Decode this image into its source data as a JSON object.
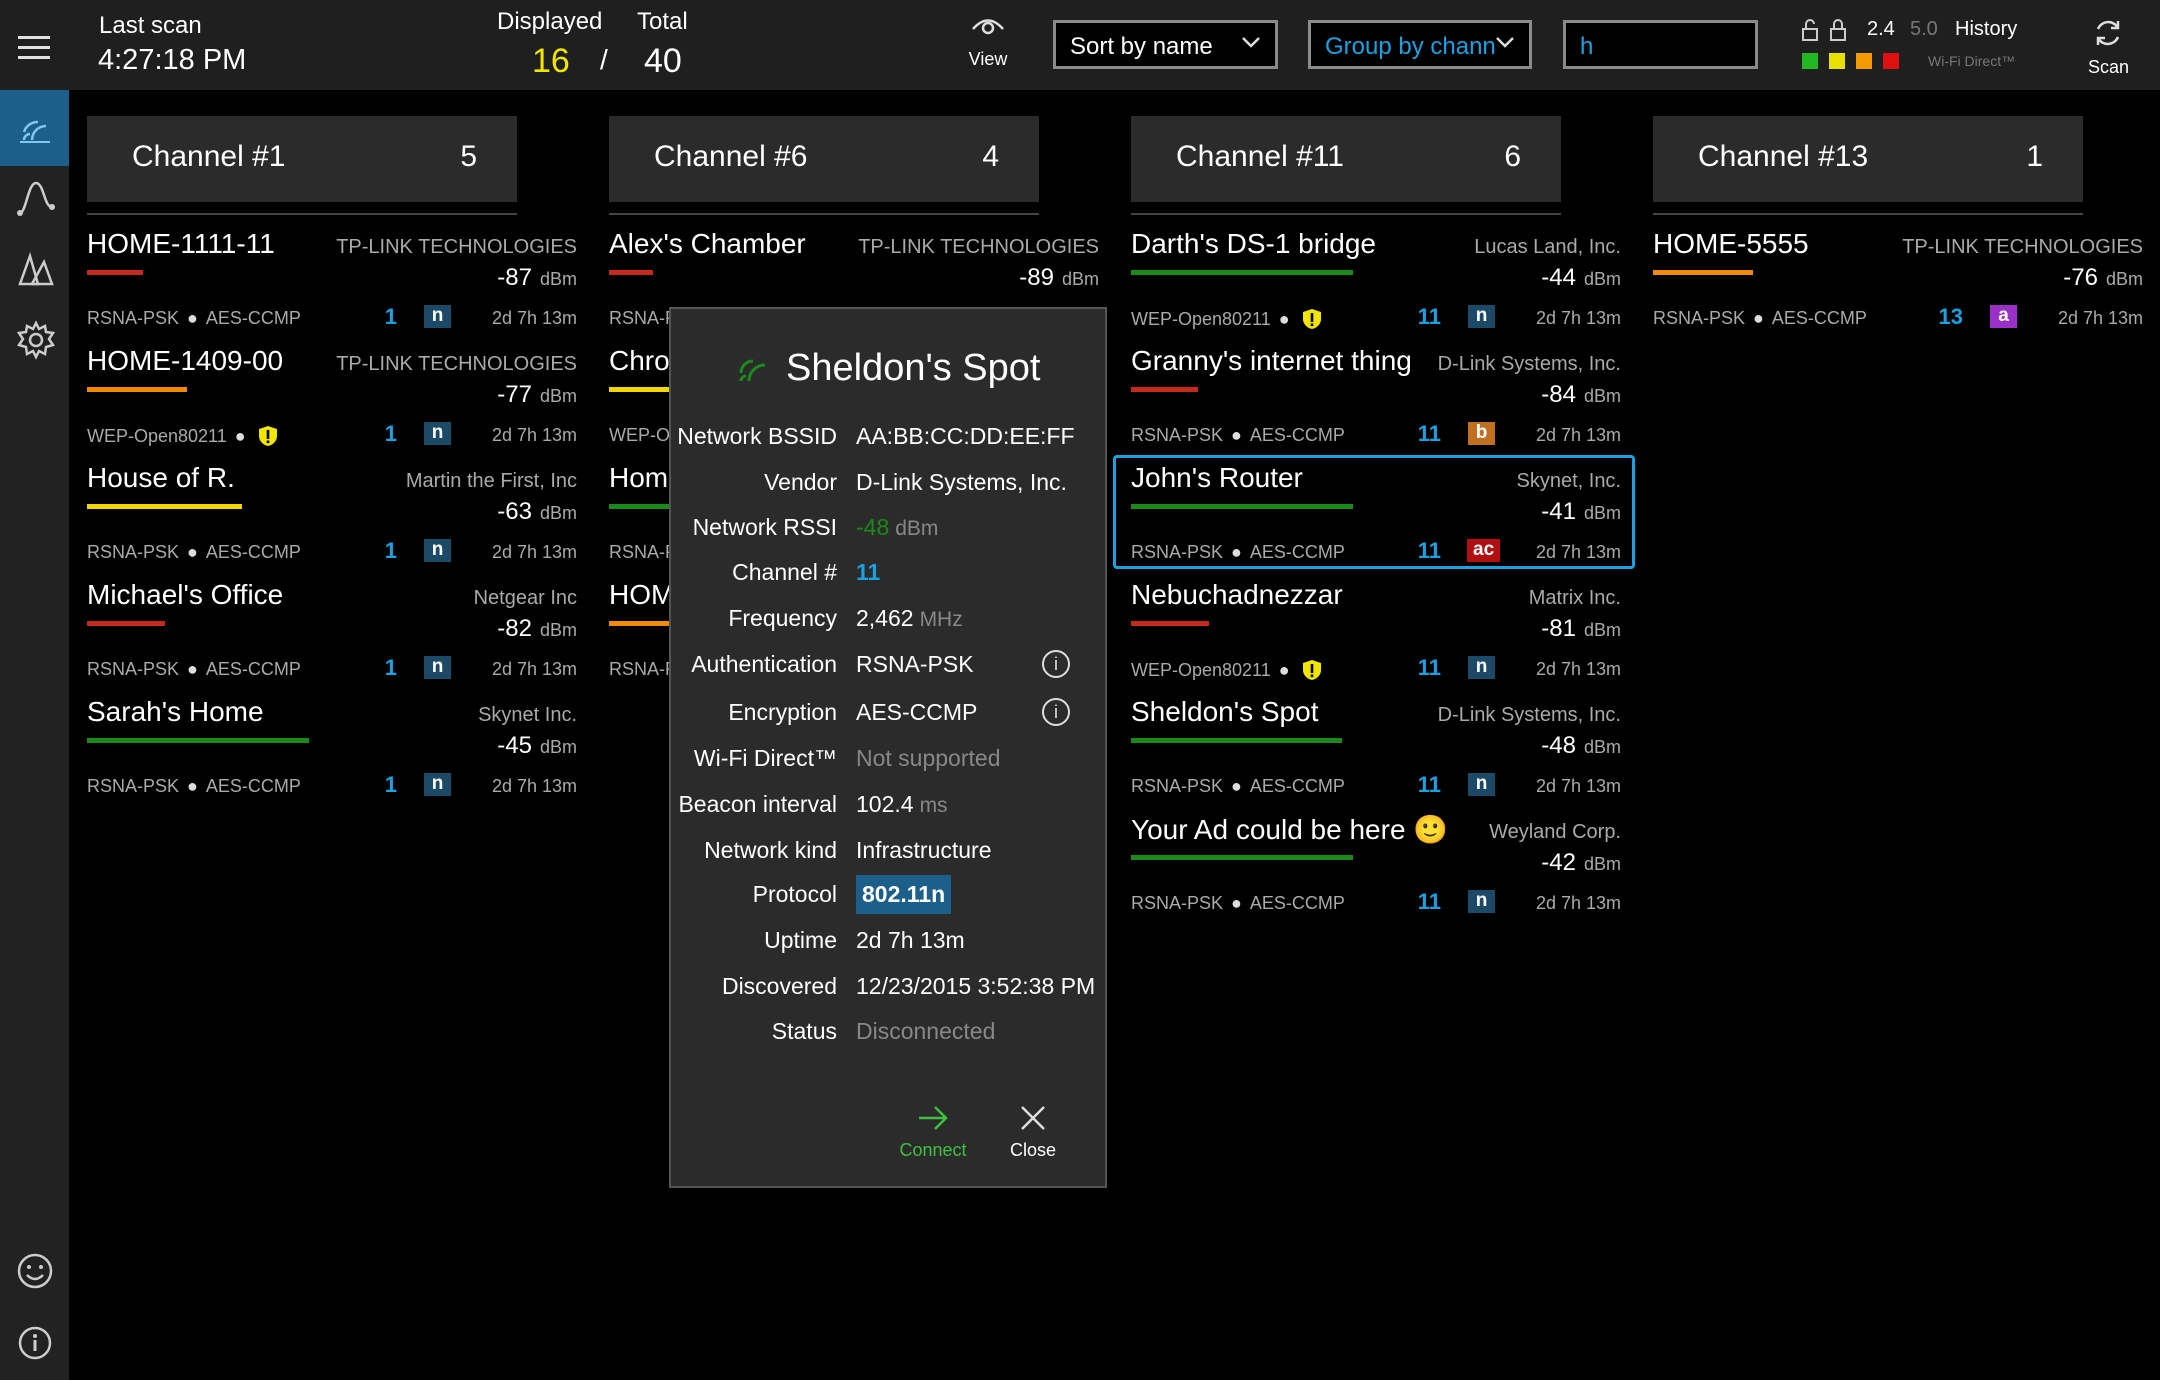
{
  "header": {
    "last_scan_label": "Last scan",
    "last_scan_time": "4:27:18 PM",
    "displayed_label": "Displayed",
    "displayed_value": "16",
    "separator": "/",
    "total_label": "Total",
    "total_value": "40",
    "view_label": "View",
    "sort_value": "Sort by name",
    "group_value": "Group by chann",
    "search_value": "h",
    "band_24": "2.4",
    "band_50": "5.0",
    "history_label": "History",
    "wifi_direct_label": "Wi-Fi Direct™",
    "scan_label": "Scan",
    "filter_colors": [
      "#22b822",
      "#e8e000",
      "#f59a00",
      "#e01010"
    ]
  },
  "sidebar": {
    "items": [
      {
        "icon": "wifi-list-icon",
        "active": true
      },
      {
        "icon": "graph-icon",
        "active": false
      },
      {
        "icon": "signal-map-icon",
        "active": false
      },
      {
        "icon": "gear-icon",
        "active": false
      }
    ],
    "bottom": [
      {
        "icon": "smiley-icon"
      },
      {
        "icon": "info-icon"
      }
    ]
  },
  "columns": [
    {
      "title": "Channel #1",
      "count": "5",
      "networks": [
        {
          "name": "HOME-1111-11",
          "vendor": "TP-LINK TECHNOLOGIES",
          "rssi": "-87",
          "unit": "dBm",
          "bar_color": "#c42b1c",
          "signal_fraction": 0.25,
          "security": "RSNA-PSK",
          "cipher": "AES-CCMP",
          "warning": false,
          "channel": "1",
          "protocol": "n",
          "protocol_color": "#1c4a66",
          "uptime": "2d 7h 13m"
        },
        {
          "name": "HOME-1409-00",
          "vendor": "TP-LINK TECHNOLOGIES",
          "rssi": "-77",
          "unit": "dBm",
          "bar_color": "#f08a00",
          "signal_fraction": 0.45,
          "security": "WEP-Open80211",
          "cipher": "",
          "warning": true,
          "channel": "1",
          "protocol": "n",
          "protocol_color": "#1c4a66",
          "uptime": "2d 7h 13m"
        },
        {
          "name": "House of R.",
          "vendor": "Martin the First, Inc",
          "rssi": "-63",
          "unit": "dBm",
          "bar_color": "#f2d600",
          "signal_fraction": 0.7,
          "security": "RSNA-PSK",
          "cipher": "AES-CCMP",
          "warning": false,
          "channel": "1",
          "protocol": "n",
          "protocol_color": "#1c4a66",
          "uptime": "2d 7h 13m"
        },
        {
          "name": "Michael's Office",
          "vendor": "Netgear Inc",
          "rssi": "-82",
          "unit": "dBm",
          "bar_color": "#c42b1c",
          "signal_fraction": 0.35,
          "security": "RSNA-PSK",
          "cipher": "AES-CCMP",
          "warning": false,
          "channel": "1",
          "protocol": "n",
          "protocol_color": "#1c4a66",
          "uptime": "2d 7h 13m"
        },
        {
          "name": "Sarah's Home",
          "vendor": "Skynet Inc.",
          "rssi": "-45",
          "unit": "dBm",
          "bar_color": "#1a8a1a",
          "signal_fraction": 1.0,
          "security": "RSNA-PSK",
          "cipher": "AES-CCMP",
          "warning": false,
          "channel": "1",
          "protocol": "n",
          "protocol_color": "#1c4a66",
          "uptime": "2d 7h 13m"
        }
      ]
    },
    {
      "title": "Channel #6",
      "count": "4",
      "networks": [
        {
          "name": "Alex's Chamber",
          "vendor": "TP-LINK TECHNOLOGIES",
          "rssi": "-89",
          "unit": "dBm",
          "bar_color": "#c42b1c",
          "signal_fraction": 0.2,
          "security": "RSNA-P",
          "cipher": "",
          "warning": false,
          "channel": "",
          "protocol": "",
          "protocol_color": "#1c4a66",
          "uptime": ""
        },
        {
          "name": "Chrom",
          "vendor": "",
          "rssi": "",
          "unit": "",
          "bar_color": "#f2d600",
          "signal_fraction": 0.3,
          "security": "WEP-Op",
          "cipher": "",
          "warning": false,
          "channel": "",
          "protocol": "",
          "protocol_color": "#1c4a66",
          "uptime": ""
        },
        {
          "name": "Home",
          "vendor": "",
          "rssi": "",
          "unit": "",
          "bar_color": "#1a8a1a",
          "signal_fraction": 0.3,
          "security": "RSNA-P",
          "cipher": "",
          "warning": false,
          "channel": "",
          "protocol": "",
          "protocol_color": "#1c4a66",
          "uptime": ""
        },
        {
          "name": "HOM",
          "vendor": "",
          "rssi": "",
          "unit": "",
          "bar_color": "#f08a00",
          "signal_fraction": 0.3,
          "security": "RSNA-P",
          "cipher": "",
          "warning": false,
          "channel": "",
          "protocol": "",
          "protocol_color": "#1c4a66",
          "uptime": ""
        }
      ]
    },
    {
      "title": "Channel #11",
      "count": "6",
      "networks": [
        {
          "name": "Darth's DS-1 bridge",
          "vendor": "Lucas Land, Inc.",
          "rssi": "-44",
          "unit": "dBm",
          "bar_color": "#1a8a1a",
          "signal_fraction": 1.0,
          "security": "WEP-Open80211",
          "cipher": "",
          "warning": true,
          "channel": "11",
          "protocol": "n",
          "protocol_color": "#1c4a66",
          "uptime": "2d 7h 13m"
        },
        {
          "name": "Granny's internet thing",
          "vendor": "D-Link Systems, Inc.",
          "rssi": "-84",
          "unit": "dBm",
          "bar_color": "#c42b1c",
          "signal_fraction": 0.3,
          "security": "RSNA-PSK",
          "cipher": "AES-CCMP",
          "warning": false,
          "channel": "11",
          "protocol": "b",
          "protocol_color": "#c07020",
          "uptime": "2d 7h 13m"
        },
        {
          "name": "John's Router",
          "vendor": "Skynet, Inc.",
          "rssi": "-41",
          "unit": "dBm",
          "bar_color": "#1a8a1a",
          "signal_fraction": 1.0,
          "security": "RSNA-PSK",
          "cipher": "AES-CCMP",
          "warning": false,
          "channel": "11",
          "protocol": "ac",
          "protocol_color": "#b01010",
          "uptime": "2d 7h 13m",
          "selected": true
        },
        {
          "name": "Nebuchadnezzar",
          "vendor": "Matrix Inc.",
          "rssi": "-81",
          "unit": "dBm",
          "bar_color": "#c42b1c",
          "signal_fraction": 0.35,
          "security": "WEP-Open80211",
          "cipher": "",
          "warning": true,
          "channel": "11",
          "protocol": "n",
          "protocol_color": "#1c4a66",
          "uptime": "2d 7h 13m"
        },
        {
          "name": "Sheldon's Spot",
          "vendor": "D-Link Systems, Inc.",
          "rssi": "-48",
          "unit": "dBm",
          "bar_color": "#1a8a1a",
          "signal_fraction": 0.95,
          "security": "RSNA-PSK",
          "cipher": "AES-CCMP",
          "warning": false,
          "channel": "11",
          "protocol": "n",
          "protocol_color": "#1c4a66",
          "uptime": "2d 7h 13m"
        },
        {
          "name": "Your Ad could be here 🙂",
          "vendor": "Weyland Corp.",
          "rssi": "-42",
          "unit": "dBm",
          "bar_color": "#1a8a1a",
          "signal_fraction": 1.0,
          "security": "RSNA-PSK",
          "cipher": "AES-CCMP",
          "warning": false,
          "channel": "11",
          "protocol": "n",
          "protocol_color": "#1c4a66",
          "uptime": "2d 7h 13m"
        }
      ]
    },
    {
      "title": "Channel #13",
      "count": "1",
      "networks": [
        {
          "name": "HOME-5555",
          "vendor": "TP-LINK TECHNOLOGIES",
          "rssi": "-76",
          "unit": "dBm",
          "bar_color": "#f08a00",
          "signal_fraction": 0.45,
          "security": "RSNA-PSK",
          "cipher": "AES-CCMP",
          "warning": false,
          "channel": "13",
          "protocol": "a",
          "protocol_color": "#9b30c8",
          "uptime": "2d 7h 13m"
        }
      ]
    }
  ],
  "dialog": {
    "title": "Sheldon's Spot",
    "rows": [
      {
        "label": "Network BSSID",
        "value": "AA:BB:CC:DD:EE:FF"
      },
      {
        "label": "Vendor",
        "value": "D-Link Systems, Inc."
      },
      {
        "label": "Network RSSI",
        "value": "-48",
        "unit": "dBm"
      },
      {
        "label": "Channel #",
        "value": "11"
      },
      {
        "label": "Frequency",
        "value": "2,462",
        "unit": "MHz"
      },
      {
        "label": "Authentication",
        "value": "RSNA-PSK"
      },
      {
        "label": "Encryption",
        "value": "AES-CCMP"
      },
      {
        "label": "Wi-Fi Direct™",
        "value": "Not supported"
      },
      {
        "label": "Beacon interval",
        "value": "102.4",
        "unit": "ms"
      },
      {
        "label": "Network kind",
        "value": "Infrastructure"
      },
      {
        "label": "Protocol",
        "value": "802.11n"
      },
      {
        "label": "Uptime",
        "value": "2d 7h 13m"
      },
      {
        "label": "Discovered",
        "value": "12/23/2015 3:52:38 PM"
      },
      {
        "label": "Status",
        "value": "Disconnected"
      }
    ],
    "connect_label": "Connect",
    "close_label": "Close"
  }
}
